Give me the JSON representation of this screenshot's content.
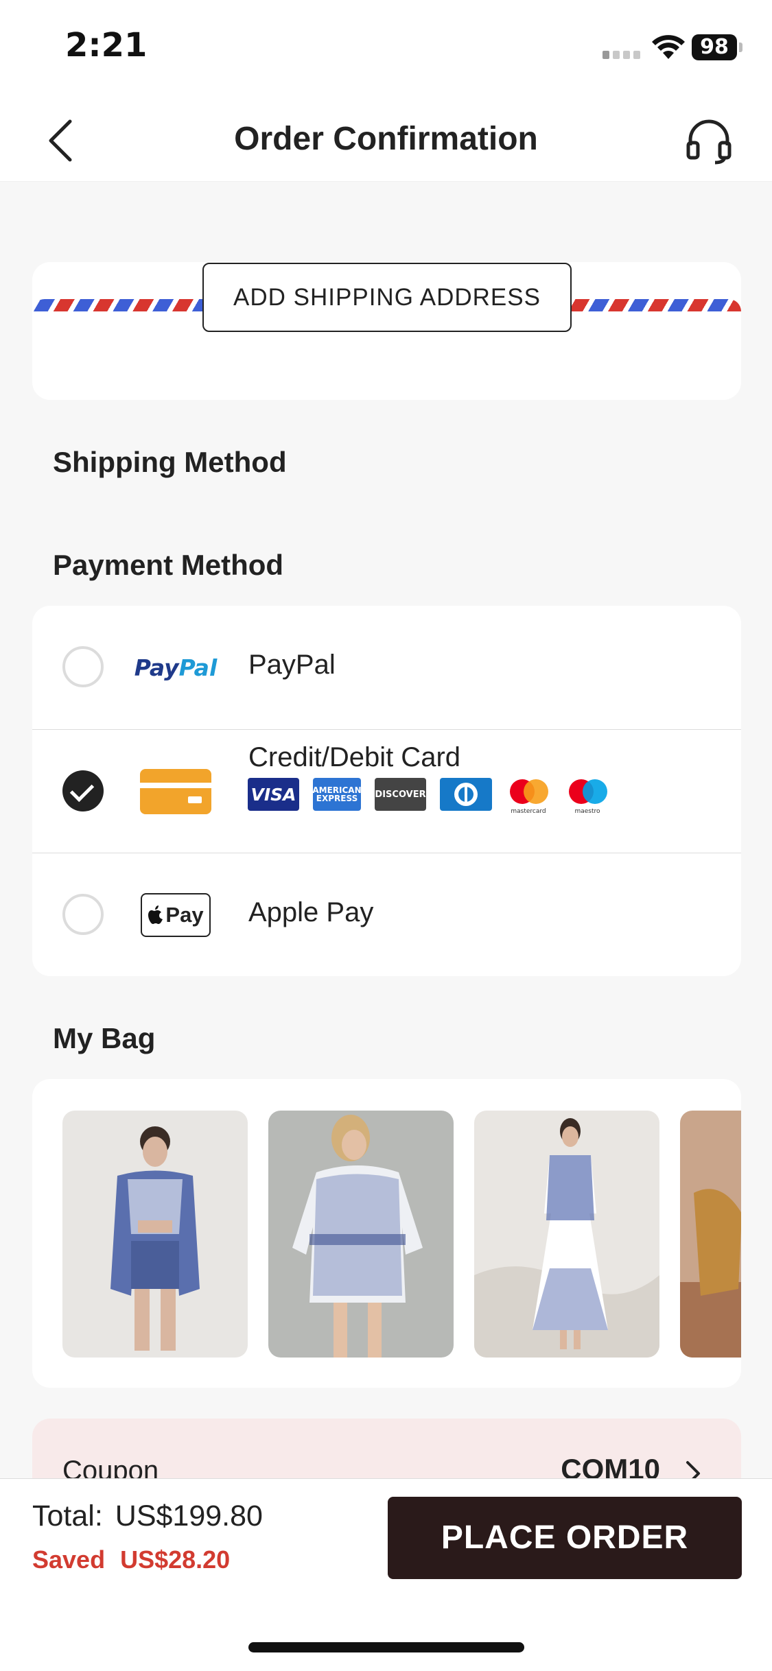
{
  "status_bar": {
    "time": "2:21",
    "battery": "98"
  },
  "header": {
    "title": "Order Confirmation"
  },
  "address": {
    "add_button_label": "ADD SHIPPING ADDRESS"
  },
  "shipping": {
    "section_title": "Shipping Method"
  },
  "payment": {
    "section_title": "Payment Method",
    "options": [
      {
        "label": "PayPal",
        "logo_text": "PayPal",
        "selected": false
      },
      {
        "label": "Credit/Debit Card",
        "selected": true,
        "brands": [
          "VISA",
          "AMERICAN EXPRESS",
          "DISCOVER",
          "Diners Club",
          "mastercard",
          "maestro"
        ]
      },
      {
        "label": "Apple Pay",
        "logo_text": "Pay",
        "selected": false
      }
    ]
  },
  "bag": {
    "section_title": "My Bag",
    "item_count_visible": 4
  },
  "coupon": {
    "label": "Coupon",
    "code": "COM10"
  },
  "summary": {
    "total_label": "Total:",
    "total_value": "US$199.80",
    "saved_label": "Saved",
    "saved_value": "US$28.20",
    "place_order_label": "PLACE ORDER"
  },
  "colors": {
    "accent_dark": "#2a1a1a",
    "saved_red": "#d23b30",
    "card_orange": "#f2a42b",
    "coupon_bg": "#f8eaea"
  }
}
